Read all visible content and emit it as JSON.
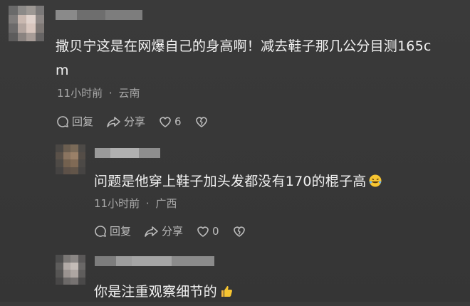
{
  "comments": [
    {
      "text_line1": "撒贝宁这是在网爆自己的身高啊！减去鞋子那几公分目测165c",
      "text_line2": "m",
      "time": "11小时前",
      "location": "云南",
      "reply_label": "回复",
      "share_label": "分享",
      "like_count": "6"
    },
    {
      "text": "问题是他穿上鞋子加头发都没有170的棍子高",
      "emoji": "rofl-emoji",
      "time": "11小时前",
      "location": "广西",
      "reply_label": "回复",
      "share_label": "分享",
      "like_count": "0"
    },
    {
      "text": "你是注重观察细节的",
      "emoji": "thumbs-up-emoji"
    }
  ],
  "meta_separator": "·"
}
